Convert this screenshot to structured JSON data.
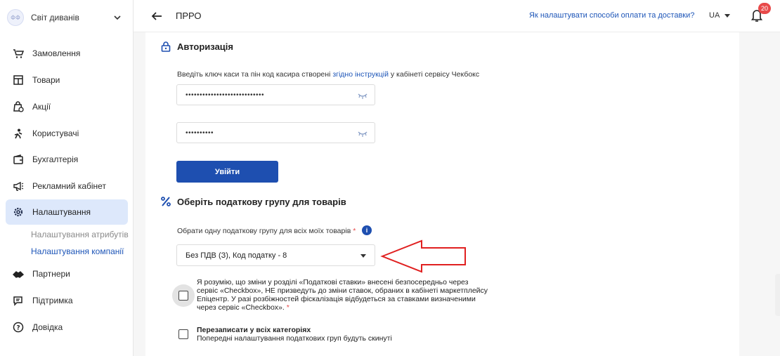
{
  "sidebar": {
    "store": {
      "avatar_text": "ФФ",
      "name": "Світ диванів"
    },
    "items": [
      {
        "label": "Замовлення",
        "icon": "cart-icon"
      },
      {
        "label": "Товари",
        "icon": "box-icon"
      },
      {
        "label": "Акції",
        "icon": "promo-bag-icon"
      },
      {
        "label": "Користувачі",
        "icon": "users-icon"
      },
      {
        "label": "Бухгалтерія",
        "icon": "wallet-icon"
      },
      {
        "label": "Рекламний кабінет",
        "icon": "megaphone-icon"
      },
      {
        "label": "Налаштування",
        "icon": "gear-icon",
        "active": true
      },
      {
        "label": "Партнери",
        "icon": "handshake-icon"
      },
      {
        "label": "Підтримка",
        "icon": "chat-icon"
      },
      {
        "label": "Довідка",
        "icon": "help-icon"
      }
    ],
    "sub_items": [
      {
        "label": "Налаштування атрибутів"
      },
      {
        "label": "Налаштування компанії",
        "active": true
      }
    ]
  },
  "header": {
    "title": "ПРРО",
    "help_link": "Як налаштувати способи оплати та доставки?",
    "language": "UA",
    "notifications_count": "20"
  },
  "auth": {
    "title": "Авторизація",
    "hint_before": "Введіть ключ каси та пін код касира створені ",
    "hint_link": "згідно інструкцій",
    "hint_after": " у кабінеті сервісу Чекбокс",
    "key_value": "••••••••••••••••••••••••••••",
    "pin_value": "••••••••••",
    "login_button": "Увійти"
  },
  "tax": {
    "title": "Оберіть податкову групу для товарів",
    "select_label": "Обрати одну податкову групу для всіх моїх товарів",
    "required_mark": "*",
    "info": "i",
    "selected_value": "Без ПДВ (З), Код податку - 8",
    "agreement_lines": [
      "Я розумію, що зміни у розділі «Податкові ставки» внесені безпосередньо через",
      "сервіс «Checkbox», НЕ призведуть до зміни ставок, обраних в кабінеті маркетплейсу",
      "Епіцентр. У разі розбіжностей фіскалізація відбудеться за ставками визначеними",
      "через сервіс «Checkbox»."
    ],
    "overwrite_title": "Перезаписати у всіх категоріях",
    "overwrite_note": "Попередні налаштування податкових груп будуть скинуті"
  },
  "colors": {
    "brand": "#1e4fb0",
    "link": "#1e56b8",
    "active_bg": "#dde8fb",
    "badge": "#e84a4a",
    "annotation_arrow": "#e02020"
  }
}
